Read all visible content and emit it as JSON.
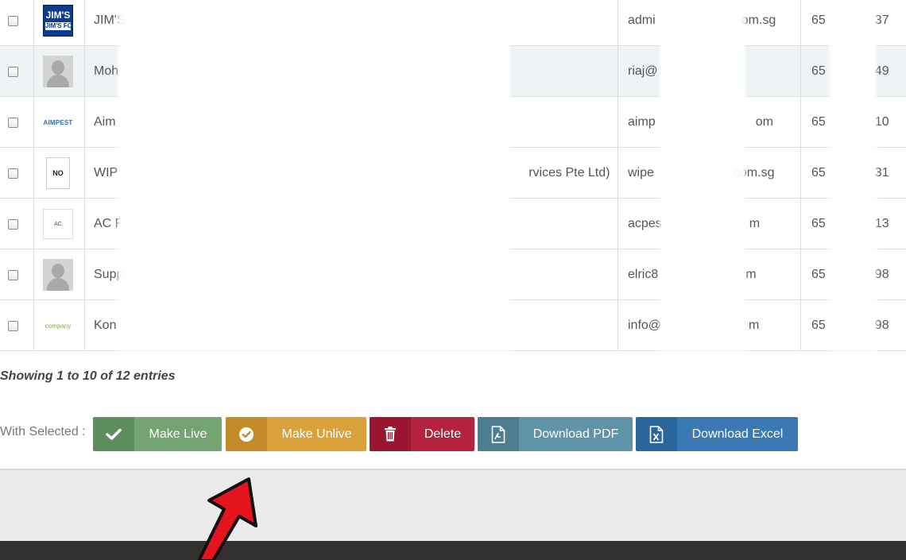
{
  "rows": [
    {
      "name": "JIM'S",
      "email": "admi",
      "email_end": "om.sg",
      "phone": "65",
      "phone_end": "37",
      "logo": "JIM'S FORCE"
    },
    {
      "name": "Moh",
      "email": "riaj@",
      "email_end": "",
      "phone": "65",
      "phone_end": "49",
      "logo": ""
    },
    {
      "name": "Aim",
      "email": "aimp",
      "email_end": "om",
      "phone": "65",
      "phone_end": "10",
      "logo": "AIMPEST"
    },
    {
      "name": "WIP",
      "name_end": "rvices Pte Ltd)",
      "email": "wipe",
      "email_end": "com.sg",
      "phone": "65",
      "phone_end": "31",
      "logo": "NO"
    },
    {
      "name": "AC F",
      "email": "acpes",
      "email_end": "m",
      "phone": "65",
      "phone_end": "13",
      "logo": "AC Pest Management Pte Ltd"
    },
    {
      "name": "Supp",
      "email": "elric8",
      "email_end": "m",
      "phone": "65",
      "phone_end": "98",
      "logo": ""
    },
    {
      "name": "Kon",
      "email": "info@",
      "email_end": "m",
      "phone": "65",
      "phone_end": "98",
      "logo": "company"
    }
  ],
  "pagination": {
    "showing": "Showing 1 to 10 of 12 entries"
  },
  "bulk": {
    "label": "With Selected :",
    "make_live": "Make Live",
    "make_unlive": "Make Unlive",
    "delete": "Delete",
    "download_pdf": "Download PDF",
    "download_excel": "Download Excel"
  },
  "colors": {
    "live": "#74a374",
    "unlive": "#dba13b",
    "delete": "#b5223d",
    "pdf": "#5f93a7",
    "excel": "#3b79b5",
    "annotation_arrow": "#e3141c"
  }
}
